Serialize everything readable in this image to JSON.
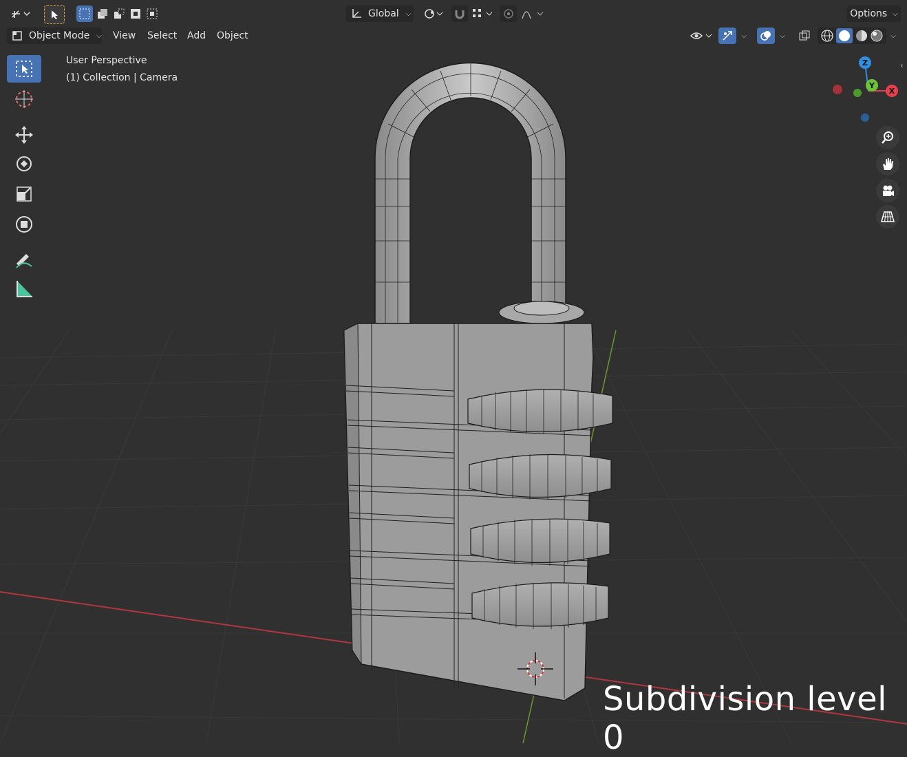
{
  "header": {
    "transform_orientation": "Global",
    "options_label": "Options"
  },
  "menu": {
    "mode": "Object Mode",
    "view": "View",
    "select": "Select",
    "add": "Add",
    "object": "Object"
  },
  "viewport_info": {
    "perspective": "User Perspective",
    "collection": "(1) Collection | Camera"
  },
  "gizmo": {
    "z": "Z",
    "y": "Y",
    "x": "X",
    "colors": {
      "x": "#e5404e",
      "y": "#6cc23a",
      "z": "#2f8fe3"
    }
  },
  "caption": "Subdivision level 0",
  "colors": {
    "accent": "#4772b3",
    "background": "#303030",
    "grid": "#3a3a3a",
    "x_axis_line": "#b1363f",
    "y_axis_line": "#6a9a2e",
    "model_fill": "#9a9a9a",
    "wire": "#1c1c1c"
  },
  "icons": {
    "editor_type": "editor-type-icon",
    "select_tool": "cursor-icon",
    "cursor_tool": "3d-cursor-icon",
    "move_tool": "move-icon",
    "rotate_tool": "rotate-icon",
    "scale_tool": "scale-icon",
    "transform_tool": "transform-icon",
    "annotate_tool": "annotate-icon",
    "measure_tool": "measure-icon",
    "zoom": "zoom-icon",
    "pan": "hand-icon",
    "camera": "camera-icon",
    "ortho": "grid-icon"
  }
}
